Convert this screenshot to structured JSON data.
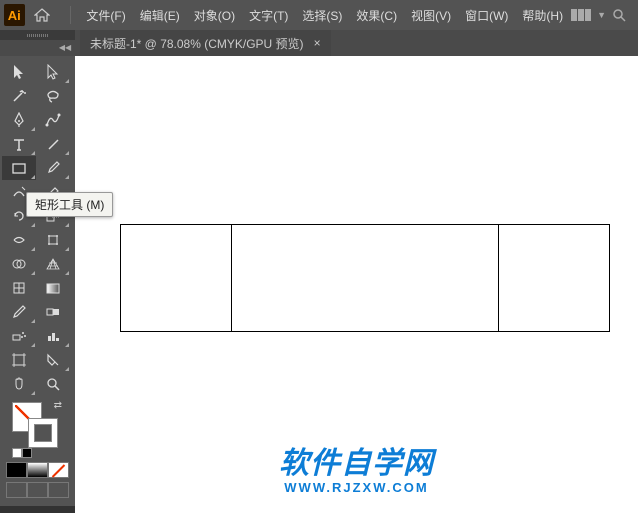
{
  "app": {
    "logo": "Ai"
  },
  "menu": {
    "items": [
      {
        "label": "文件(F)"
      },
      {
        "label": "编辑(E)"
      },
      {
        "label": "对象(O)"
      },
      {
        "label": "文字(T)"
      },
      {
        "label": "选择(S)"
      },
      {
        "label": "效果(C)"
      },
      {
        "label": "视图(V)"
      },
      {
        "label": "窗口(W)"
      },
      {
        "label": "帮助(H)"
      }
    ]
  },
  "document": {
    "tab_title": "未标题-1* @ 78.08%  (CMYK/GPU 预览)",
    "close": "×"
  },
  "tooltip": {
    "text": "矩形工具 (M)"
  },
  "watermark": {
    "main": "软件自学网",
    "sub": "WWW.RJZXW.COM"
  },
  "tools": {
    "selection": "selection-tool",
    "direct_selection": "direct-selection-tool",
    "magic_wand": "magic-wand-tool",
    "lasso": "lasso-tool",
    "pen": "pen-tool",
    "curvature": "curvature-tool",
    "type": "type-tool",
    "line": "line-segment-tool",
    "rectangle": "rectangle-tool",
    "paintbrush": "paintbrush-tool",
    "shaper": "shaper-tool",
    "eraser": "eraser-tool",
    "rotate": "rotate-tool",
    "scale": "scale-tool",
    "width": "width-tool",
    "free_transform": "free-transform-tool",
    "shape_builder": "shape-builder-tool",
    "perspective": "perspective-grid-tool",
    "mesh": "mesh-tool",
    "gradient": "gradient-tool",
    "eyedropper": "eyedropper-tool",
    "blend": "blend-tool",
    "symbol_sprayer": "symbol-sprayer-tool",
    "column_graph": "column-graph-tool",
    "artboard": "artboard-tool",
    "slice": "slice-tool",
    "hand": "hand-tool",
    "zoom": "zoom-tool"
  }
}
